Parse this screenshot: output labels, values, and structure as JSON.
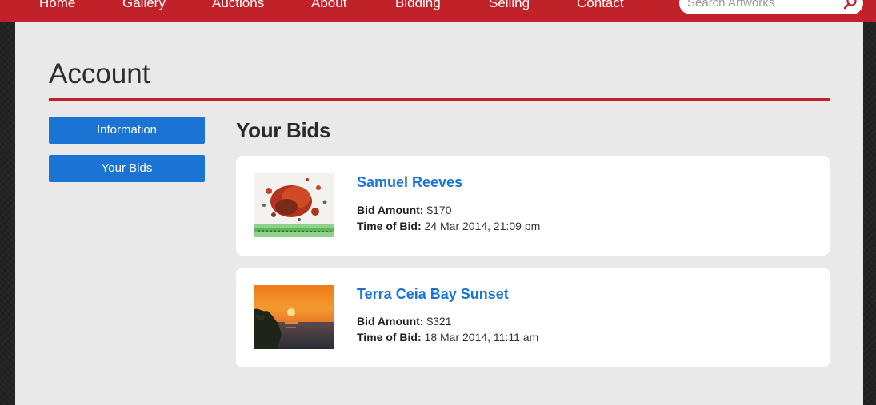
{
  "nav": {
    "items": [
      "Home",
      "Gallery",
      "Auctions",
      "About",
      "Bidding",
      "Selling",
      "Contact"
    ],
    "search_placeholder": "Search Artworks"
  },
  "page": {
    "title": "Account",
    "section_title": "Your Bids"
  },
  "sidebar": {
    "items": [
      {
        "label": "Information"
      },
      {
        "label": "Your Bids"
      }
    ]
  },
  "bids": [
    {
      "title": "Samuel Reeves",
      "amount_label": "Bid Amount:",
      "amount": "$170",
      "time_label": "Time of Bid:",
      "time": "24 Mar 2014, 21:09 pm"
    },
    {
      "title": "Terra Ceia Bay Sunset",
      "amount_label": "Bid Amount:",
      "amount": "$321",
      "time_label": "Time of Bid:",
      "time": "18 Mar 2014, 11:11 am"
    }
  ],
  "colors": {
    "brand_red": "#c1222a",
    "link_blue": "#1b73d3",
    "panel_bg": "#e9e9e9"
  }
}
